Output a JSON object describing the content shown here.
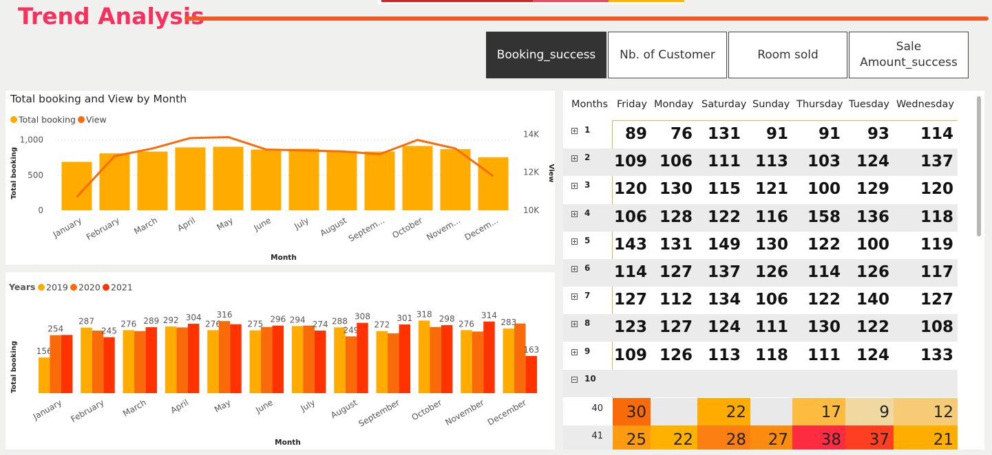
{
  "title": "Trend Analysis",
  "top_strip_colors": [
    "#c62828",
    "#e84a5f",
    "#ffb400"
  ],
  "colors": {
    "title": "#f5325f",
    "rule": "#f15a24",
    "bar_main": "#ffab00",
    "line_view": "#f96b0a",
    "y2019": "#ffab00",
    "y2020": "#f96b0a",
    "y2021": "#ff3300"
  },
  "tabs": [
    {
      "label": "Booking_success",
      "active": true
    },
    {
      "label": "Nb. of Customer",
      "active": false
    },
    {
      "label": "Room sold",
      "active": false
    },
    {
      "label": "Sale\nAmount_success",
      "active": false
    }
  ],
  "chart_data": [
    {
      "type": "bar+line",
      "title": "Total booking and View by Month",
      "legend": [
        "Total booking",
        "View"
      ],
      "legend_position": "top-left",
      "xlabel": "Month",
      "ylabel": "Total booking",
      "y2label": "View",
      "categories": [
        "January",
        "February",
        "March",
        "April",
        "May",
        "June",
        "July",
        "August",
        "Septem...",
        "October",
        "Novem...",
        "Decem..."
      ],
      "series": [
        {
          "name": "Total booking",
          "kind": "bar",
          "values": [
            690,
            810,
            835,
            895,
            905,
            865,
            875,
            845,
            835,
            915,
            870,
            755
          ]
        },
        {
          "name": "View",
          "kind": "line",
          "axis": "right",
          "values": [
            10700,
            12850,
            13250,
            13800,
            13850,
            13200,
            13150,
            13100,
            12950,
            13700,
            13250,
            11800
          ]
        }
      ],
      "ylim": [
        0,
        1100
      ],
      "y_ticks": [
        0,
        500,
        1000
      ],
      "y_tick_labels": [
        "0",
        "500",
        "1,000"
      ],
      "y2lim": [
        10000,
        14300
      ],
      "y2_ticks": [
        10000,
        12000,
        14000
      ],
      "y2_tick_labels": [
        "10K",
        "12K",
        "14K"
      ],
      "grid": true
    },
    {
      "type": "bar",
      "legend_title": "Years",
      "legend": [
        "2019",
        "2020",
        "2021"
      ],
      "legend_position": "top-left",
      "xlabel": "Month",
      "ylabel": "Total booking",
      "categories": [
        "January",
        "February",
        "March",
        "April",
        "May",
        "June",
        "July",
        "August",
        "September",
        "October",
        "November",
        "December"
      ],
      "series": [
        {
          "name": "2019",
          "values": [
            156,
            287,
            276,
            292,
            276,
            275,
            294,
            288,
            272,
            318,
            276,
            283
          ]
        },
        {
          "name": "2020",
          "values": [
            254,
            274,
            272,
            288,
            316,
            290,
            296,
            249,
            262,
            290,
            270,
            305
          ]
        },
        {
          "name": "2021",
          "values": [
            255,
            245,
            289,
            304,
            302,
            296,
            274,
            308,
            301,
            298,
            314,
            163
          ]
        }
      ],
      "labels": {
        "2019": [
          "156",
          "287",
          "276",
          "292",
          "276",
          "275",
          "294",
          "288",
          "272",
          "318",
          "276",
          "283"
        ],
        "2020": [
          "254",
          "",
          "",
          "",
          "316",
          "",
          "",
          "249",
          "",
          "",
          "",
          ""
        ],
        "2021": [
          "",
          "245",
          "289",
          "304",
          "",
          "296",
          "274",
          "308",
          "301",
          "298",
          "314",
          "163"
        ]
      },
      "ylim": [
        0,
        360
      ],
      "grid": false
    }
  ],
  "matrix": {
    "headers": [
      "Months",
      "Friday",
      "Monday",
      "Saturday",
      "Sunday",
      "Thursday",
      "Tuesday",
      "Wednesday"
    ],
    "rows": [
      {
        "label": "1",
        "values": [
          "89",
          "76",
          "131",
          "91",
          "91",
          "93",
          "114"
        ]
      },
      {
        "label": "2",
        "values": [
          "109",
          "106",
          "111",
          "113",
          "103",
          "124",
          "137"
        ]
      },
      {
        "label": "3",
        "values": [
          "120",
          "130",
          "115",
          "121",
          "100",
          "129",
          "120"
        ]
      },
      {
        "label": "4",
        "values": [
          "106",
          "128",
          "122",
          "116",
          "158",
          "136",
          "118"
        ]
      },
      {
        "label": "5",
        "values": [
          "143",
          "131",
          "149",
          "130",
          "122",
          "100",
          "119"
        ]
      },
      {
        "label": "6",
        "values": [
          "114",
          "127",
          "137",
          "126",
          "114",
          "126",
          "117"
        ]
      },
      {
        "label": "7",
        "values": [
          "127",
          "112",
          "134",
          "106",
          "122",
          "140",
          "127"
        ]
      },
      {
        "label": "8",
        "values": [
          "123",
          "127",
          "124",
          "111",
          "130",
          "122",
          "108"
        ]
      },
      {
        "label": "9",
        "values": [
          "109",
          "126",
          "113",
          "118",
          "111",
          "124",
          "133"
        ]
      },
      {
        "label": "10",
        "values": [],
        "expanded": true
      }
    ],
    "sub_rows": [
      {
        "label": "40",
        "values": [
          "30",
          "",
          "22",
          "",
          "17",
          "9",
          "12"
        ],
        "colors": [
          "#f96b0a",
          "#e9e9e9",
          "#ffab00",
          "#e9e9e9",
          "#fdbb40",
          "#f0d9a0",
          "#f6cb75"
        ]
      },
      {
        "label": "41",
        "values": [
          "25",
          "22",
          "28",
          "27",
          "38",
          "37",
          "21"
        ],
        "colors": [
          "#fc9a10",
          "#ffb100",
          "#fb7f12",
          "#fc8c10",
          "#fe2c40",
          "#ff3e22",
          "#ffae00"
        ]
      }
    ]
  }
}
